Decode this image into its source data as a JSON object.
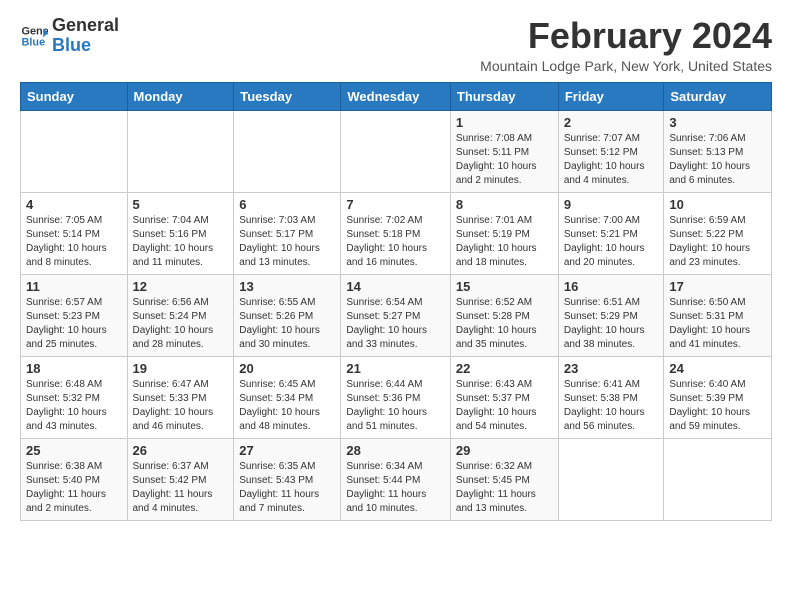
{
  "logo": {
    "line1": "General",
    "line2": "Blue"
  },
  "title": "February 2024",
  "subtitle": "Mountain Lodge Park, New York, United States",
  "days_of_week": [
    "Sunday",
    "Monday",
    "Tuesday",
    "Wednesday",
    "Thursday",
    "Friday",
    "Saturday"
  ],
  "weeks": [
    [
      {
        "num": "",
        "info": ""
      },
      {
        "num": "",
        "info": ""
      },
      {
        "num": "",
        "info": ""
      },
      {
        "num": "",
        "info": ""
      },
      {
        "num": "1",
        "info": "Sunrise: 7:08 AM\nSunset: 5:11 PM\nDaylight: 10 hours\nand 2 minutes."
      },
      {
        "num": "2",
        "info": "Sunrise: 7:07 AM\nSunset: 5:12 PM\nDaylight: 10 hours\nand 4 minutes."
      },
      {
        "num": "3",
        "info": "Sunrise: 7:06 AM\nSunset: 5:13 PM\nDaylight: 10 hours\nand 6 minutes."
      }
    ],
    [
      {
        "num": "4",
        "info": "Sunrise: 7:05 AM\nSunset: 5:14 PM\nDaylight: 10 hours\nand 8 minutes."
      },
      {
        "num": "5",
        "info": "Sunrise: 7:04 AM\nSunset: 5:16 PM\nDaylight: 10 hours\nand 11 minutes."
      },
      {
        "num": "6",
        "info": "Sunrise: 7:03 AM\nSunset: 5:17 PM\nDaylight: 10 hours\nand 13 minutes."
      },
      {
        "num": "7",
        "info": "Sunrise: 7:02 AM\nSunset: 5:18 PM\nDaylight: 10 hours\nand 16 minutes."
      },
      {
        "num": "8",
        "info": "Sunrise: 7:01 AM\nSunset: 5:19 PM\nDaylight: 10 hours\nand 18 minutes."
      },
      {
        "num": "9",
        "info": "Sunrise: 7:00 AM\nSunset: 5:21 PM\nDaylight: 10 hours\nand 20 minutes."
      },
      {
        "num": "10",
        "info": "Sunrise: 6:59 AM\nSunset: 5:22 PM\nDaylight: 10 hours\nand 23 minutes."
      }
    ],
    [
      {
        "num": "11",
        "info": "Sunrise: 6:57 AM\nSunset: 5:23 PM\nDaylight: 10 hours\nand 25 minutes."
      },
      {
        "num": "12",
        "info": "Sunrise: 6:56 AM\nSunset: 5:24 PM\nDaylight: 10 hours\nand 28 minutes."
      },
      {
        "num": "13",
        "info": "Sunrise: 6:55 AM\nSunset: 5:26 PM\nDaylight: 10 hours\nand 30 minutes."
      },
      {
        "num": "14",
        "info": "Sunrise: 6:54 AM\nSunset: 5:27 PM\nDaylight: 10 hours\nand 33 minutes."
      },
      {
        "num": "15",
        "info": "Sunrise: 6:52 AM\nSunset: 5:28 PM\nDaylight: 10 hours\nand 35 minutes."
      },
      {
        "num": "16",
        "info": "Sunrise: 6:51 AM\nSunset: 5:29 PM\nDaylight: 10 hours\nand 38 minutes."
      },
      {
        "num": "17",
        "info": "Sunrise: 6:50 AM\nSunset: 5:31 PM\nDaylight: 10 hours\nand 41 minutes."
      }
    ],
    [
      {
        "num": "18",
        "info": "Sunrise: 6:48 AM\nSunset: 5:32 PM\nDaylight: 10 hours\nand 43 minutes."
      },
      {
        "num": "19",
        "info": "Sunrise: 6:47 AM\nSunset: 5:33 PM\nDaylight: 10 hours\nand 46 minutes."
      },
      {
        "num": "20",
        "info": "Sunrise: 6:45 AM\nSunset: 5:34 PM\nDaylight: 10 hours\nand 48 minutes."
      },
      {
        "num": "21",
        "info": "Sunrise: 6:44 AM\nSunset: 5:36 PM\nDaylight: 10 hours\nand 51 minutes."
      },
      {
        "num": "22",
        "info": "Sunrise: 6:43 AM\nSunset: 5:37 PM\nDaylight: 10 hours\nand 54 minutes."
      },
      {
        "num": "23",
        "info": "Sunrise: 6:41 AM\nSunset: 5:38 PM\nDaylight: 10 hours\nand 56 minutes."
      },
      {
        "num": "24",
        "info": "Sunrise: 6:40 AM\nSunset: 5:39 PM\nDaylight: 10 hours\nand 59 minutes."
      }
    ],
    [
      {
        "num": "25",
        "info": "Sunrise: 6:38 AM\nSunset: 5:40 PM\nDaylight: 11 hours\nand 2 minutes."
      },
      {
        "num": "26",
        "info": "Sunrise: 6:37 AM\nSunset: 5:42 PM\nDaylight: 11 hours\nand 4 minutes."
      },
      {
        "num": "27",
        "info": "Sunrise: 6:35 AM\nSunset: 5:43 PM\nDaylight: 11 hours\nand 7 minutes."
      },
      {
        "num": "28",
        "info": "Sunrise: 6:34 AM\nSunset: 5:44 PM\nDaylight: 11 hours\nand 10 minutes."
      },
      {
        "num": "29",
        "info": "Sunrise: 6:32 AM\nSunset: 5:45 PM\nDaylight: 11 hours\nand 13 minutes."
      },
      {
        "num": "",
        "info": ""
      },
      {
        "num": "",
        "info": ""
      }
    ]
  ]
}
